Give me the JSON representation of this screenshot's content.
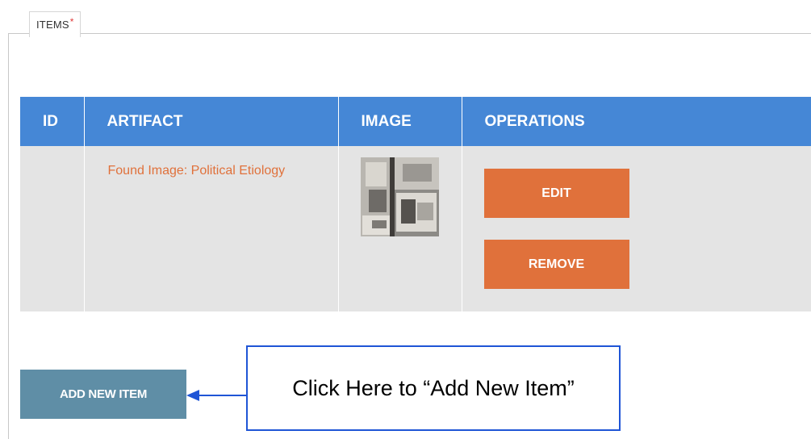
{
  "section": {
    "legend_label": "ITEMS",
    "required_marker": "*"
  },
  "table": {
    "headers": {
      "id": "ID",
      "artifact": "ARTIFACT",
      "image": "IMAGE",
      "operations": "OPERATIONS"
    },
    "rows": [
      {
        "id": "",
        "artifact_title": "Found Image: Political Etiology",
        "image_alt": "artifact thumbnail",
        "edit_label": "EDIT",
        "remove_label": "REMOVE"
      }
    ]
  },
  "actions": {
    "add_new_item_label": "ADD NEW ITEM"
  },
  "annotation": {
    "callout_text": "Click Here to “Add New Item”"
  },
  "colors": {
    "header_blue": "#4587d6",
    "row_gray": "#e4e4e4",
    "action_orange": "#e0713b",
    "add_button_teal": "#5f8ea6",
    "callout_border_blue": "#1f55d6",
    "required_red": "#e03a3a"
  },
  "icons": {
    "callout_pointer": "arrow-left-icon"
  }
}
